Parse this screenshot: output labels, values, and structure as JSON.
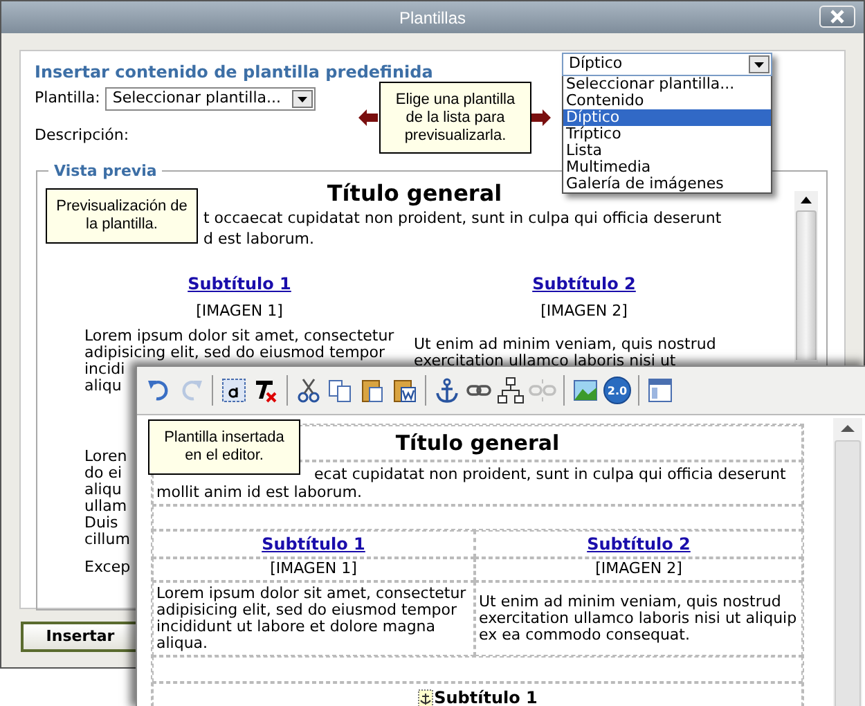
{
  "window": {
    "title": "Plantillas"
  },
  "heading": "Insertar contenido de plantilla predefinida",
  "template_field": {
    "label": "Plantilla:",
    "value": "Seleccionar plantilla..."
  },
  "description_label": "Descripción:",
  "dropdown": {
    "value": "Díptico",
    "expanded": true,
    "options": [
      {
        "label": "Seleccionar plantilla...",
        "selected": false
      },
      {
        "label": "Contenido",
        "selected": false
      },
      {
        "label": "Díptico",
        "selected": true
      },
      {
        "label": "Tríptico",
        "selected": false
      },
      {
        "label": "Lista",
        "selected": false
      },
      {
        "label": "Multimedia",
        "selected": false
      },
      {
        "label": "Galería de imágenes",
        "selected": false
      }
    ]
  },
  "hints": [
    {
      "kind": "arrows",
      "text": "Elige una plantilla de la lista para previsualizarla."
    },
    {
      "kind": "preview",
      "text": "Previsualización de la plantilla."
    },
    {
      "kind": "editor",
      "text": "Plantilla insertada en el editor."
    }
  ],
  "preview": {
    "legend": "Vista previa",
    "title": "Título general",
    "intro_lines": [
      "t occaecat cupidatat non proident, sunt in culpa qui officia deserunt",
      "d est laborum."
    ],
    "columns": [
      {
        "subtitle": "Subtítulo 1",
        "image": "[IMAGEN 1]",
        "lines": [
          "Lorem ipsum dolor sit amet, consectetur",
          "adipisicing elit, sed do eiusmod tempor",
          "incidi",
          "aliqu"
        ]
      },
      {
        "subtitle": "Subtítulo 2",
        "image": "[IMAGEN 2]",
        "lines": [
          "Ut enim ad minim veniam, quis nostrud",
          "exercitation ullamco laboris nisi ut"
        ]
      }
    ],
    "lower_lines": [
      "Loren",
      "do ei",
      "aliqu",
      "ullam",
      "Duis",
      "cillum"
    ],
    "last_line": "Excep"
  },
  "editor": {
    "toolbar": [
      {
        "kind": "undo",
        "disabled": false
      },
      {
        "kind": "redo",
        "disabled": true
      },
      {
        "kind": "separator"
      },
      {
        "kind": "select-all",
        "disabled": false
      },
      {
        "kind": "remove-format",
        "disabled": false
      },
      {
        "kind": "separator"
      },
      {
        "kind": "cut",
        "disabled": false
      },
      {
        "kind": "copy",
        "disabled": false
      },
      {
        "kind": "paste",
        "disabled": false
      },
      {
        "kind": "paste-word",
        "disabled": false
      },
      {
        "kind": "separator"
      },
      {
        "kind": "anchor",
        "disabled": false
      },
      {
        "kind": "link",
        "disabled": false
      },
      {
        "kind": "sitemap",
        "disabled": false
      },
      {
        "kind": "unlink",
        "disabled": true
      },
      {
        "kind": "separator"
      },
      {
        "kind": "image",
        "disabled": false
      },
      {
        "kind": "badge",
        "label": "2.0",
        "disabled": false
      },
      {
        "kind": "separator"
      },
      {
        "kind": "templates",
        "disabled": false
      }
    ],
    "title": "Título general",
    "intro": "ecat cupidatat non proident, sunt in culpa qui officia deserunt",
    "intro_line2": "mollit anim id est laborum.",
    "columns": [
      {
        "subtitle": "Subtítulo 1",
        "image": "[IMAGEN 1]",
        "text": "Lorem ipsum dolor sit amet, consectetur adipisicing elit, sed do eiusmod tempor incididunt ut labore et dolore magna aliqua."
      },
      {
        "subtitle": "Subtítulo 2",
        "image": "[IMAGEN 2]",
        "text": "Ut enim ad minim veniam, quis nostrud exercitation ullamco laboris nisi ut aliquip ex ea commodo consequat."
      }
    ],
    "next_subtitle": "Subtítulo 1"
  },
  "buttons": [
    {
      "label": "Insertar"
    }
  ]
}
